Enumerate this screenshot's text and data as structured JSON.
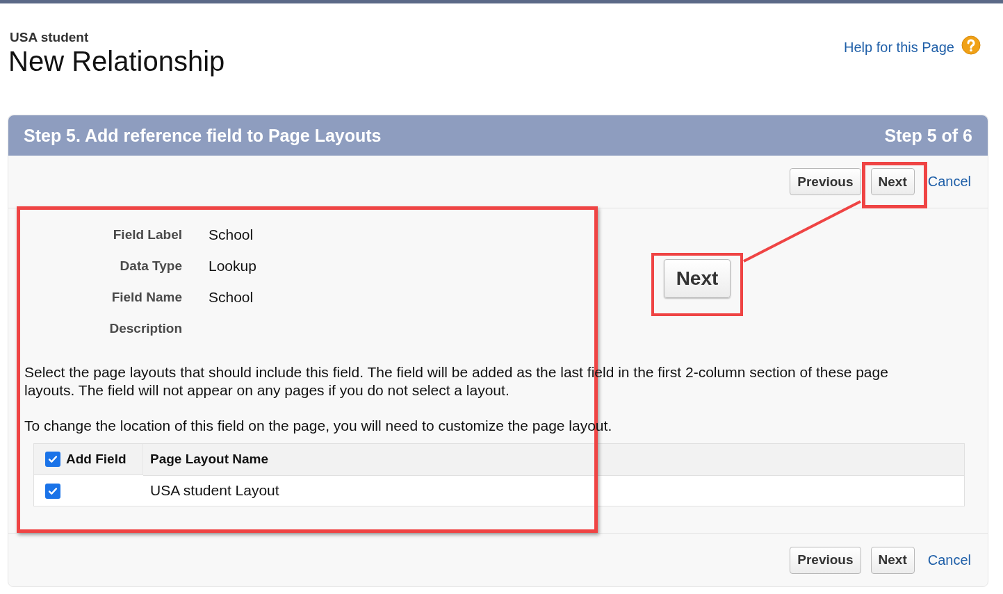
{
  "header": {
    "object": "USA student",
    "title": "New Relationship",
    "help_link": "Help for this Page"
  },
  "step": {
    "title": "Step 5. Add reference field to Page Layouts",
    "counter": "Step 5 of 6"
  },
  "buttons_top": [
    {
      "label": "Previous",
      "kind": "button"
    },
    {
      "label": "Next",
      "kind": "button"
    },
    {
      "label": "Cancel",
      "kind": "link"
    }
  ],
  "details": [
    {
      "label": "Field Label",
      "value": "School"
    },
    {
      "label": "Data Type",
      "value": "Lookup"
    },
    {
      "label": "Field Name",
      "value": "School"
    },
    {
      "label": "Description"
    }
  ],
  "instructions": [
    "Select the page layouts that should include this field. The field will be added as the last field in the first 2-column section of these page layouts. The field will not appear on any pages if you do not select a layout.",
    "To change the location of this field on the page, you will need to customize the page layout."
  ],
  "table": {
    "columns": [
      {
        "label": "Add Field",
        "checked": true
      },
      {
        "label": "Page Layout Name"
      }
    ],
    "rows": [
      {
        "checked": true,
        "name": "USA student Layout"
      }
    ]
  },
  "buttons_bottom": [
    {
      "label": "Previous",
      "kind": "button"
    },
    {
      "label": "Next",
      "kind": "button"
    },
    {
      "label": "Cancel",
      "kind": "link"
    }
  ],
  "callout": {
    "label": "Next"
  }
}
